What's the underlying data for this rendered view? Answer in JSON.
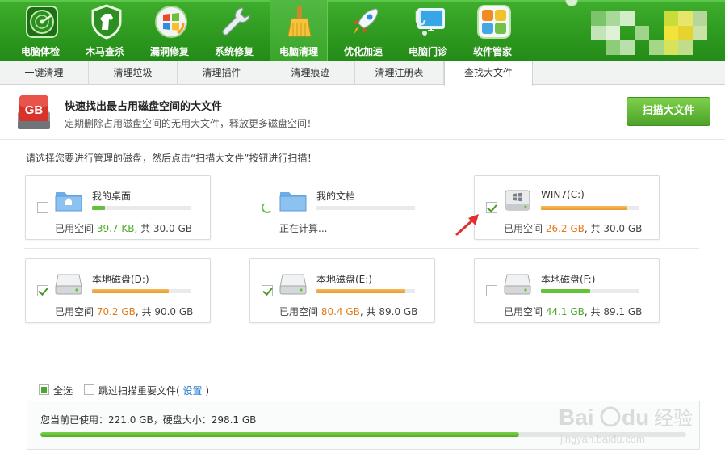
{
  "toolbar": {
    "items": [
      {
        "label": "电脑体检",
        "icon": "radar-check-icon"
      },
      {
        "label": "木马查杀",
        "icon": "horse-shield-icon"
      },
      {
        "label": "漏洞修复",
        "icon": "windows-patch-icon"
      },
      {
        "label": "系统修复",
        "icon": "wrench-icon"
      },
      {
        "label": "电脑清理",
        "icon": "broom-icon",
        "active": true
      },
      {
        "label": "优化加速",
        "icon": "rocket-icon"
      },
      {
        "label": "电脑门诊",
        "icon": "stethoscope-monitor-icon"
      },
      {
        "label": "软件管家",
        "icon": "apps-grid-icon"
      }
    ]
  },
  "tabs": [
    {
      "label": "一键清理"
    },
    {
      "label": "清理垃圾"
    },
    {
      "label": "清理插件"
    },
    {
      "label": "清理痕迹"
    },
    {
      "label": "清理注册表"
    },
    {
      "label": "查找大文件",
      "active": true
    }
  ],
  "header": {
    "icon_text": "GB",
    "title": "快速找出最占用磁盘空间的大文件",
    "subtitle": "定期删除占用磁盘空间的无用大文件，释放更多磁盘空间！",
    "scan_button": "扫描大文件"
  },
  "instruction": "请选择您要进行管理的磁盘，然后点击“扫描大文件”按钮进行扫描！",
  "drives": [
    {
      "name": "我的桌面",
      "checked": false,
      "status": "done",
      "used_prefix": "已用空间 ",
      "used": "39.7 KB",
      "total_text": ", 共 30.0 GB",
      "usage_fraction": 0.13,
      "color": "green",
      "icon": "desktop-folder-icon"
    },
    {
      "name": "我的文档",
      "checked": null,
      "status": "calculating",
      "status_text": "正在计算...",
      "usage_fraction": 0,
      "color": "green",
      "icon": "documents-folder-icon"
    },
    {
      "name": "WIN7(C:)",
      "checked": true,
      "status": "done",
      "used_prefix": "已用空间 ",
      "used": "26.2 GB",
      "total_text": ", 共 30.0 GB",
      "usage_fraction": 0.87,
      "color": "orange",
      "icon": "system-drive-icon"
    },
    {
      "name": "本地磁盘(D:)",
      "checked": true,
      "status": "done",
      "used_prefix": "已用空间 ",
      "used": "70.2 GB",
      "total_text": ", 共 90.0 GB",
      "usage_fraction": 0.78,
      "color": "orange",
      "icon": "hard-drive-icon"
    },
    {
      "name": "本地磁盘(E:)",
      "checked": true,
      "status": "done",
      "used_prefix": "已用空间 ",
      "used": "80.4 GB",
      "total_text": ", 共 89.0 GB",
      "usage_fraction": 0.9,
      "color": "orange",
      "icon": "hard-drive-icon"
    },
    {
      "name": "本地磁盘(F:)",
      "checked": false,
      "status": "done",
      "used_prefix": "已用空间 ",
      "used": "44.1 GB",
      "total_text": ", 共 89.1 GB",
      "usage_fraction": 0.5,
      "color": "green",
      "icon": "hard-drive-icon"
    }
  ],
  "bottom": {
    "select_all": "全选",
    "select_all_checked": true,
    "skip_label": "跳过扫描重要文件(",
    "settings_link": "设置",
    "skip_close": ")",
    "skip_checked": false,
    "usage_text": "您当前已使用：221.0 GB，硬盘大小：298.1 GB",
    "usage_fraction": 0.741
  },
  "watermark": {
    "brand": "Bai du 经验",
    "url": "jingyan.baidu.com"
  },
  "colors": {
    "brand_green": "#2e9a1f",
    "accent_orange": "#e27a1c",
    "link_blue": "#1d77c7",
    "annotation_red": "#e03030"
  }
}
